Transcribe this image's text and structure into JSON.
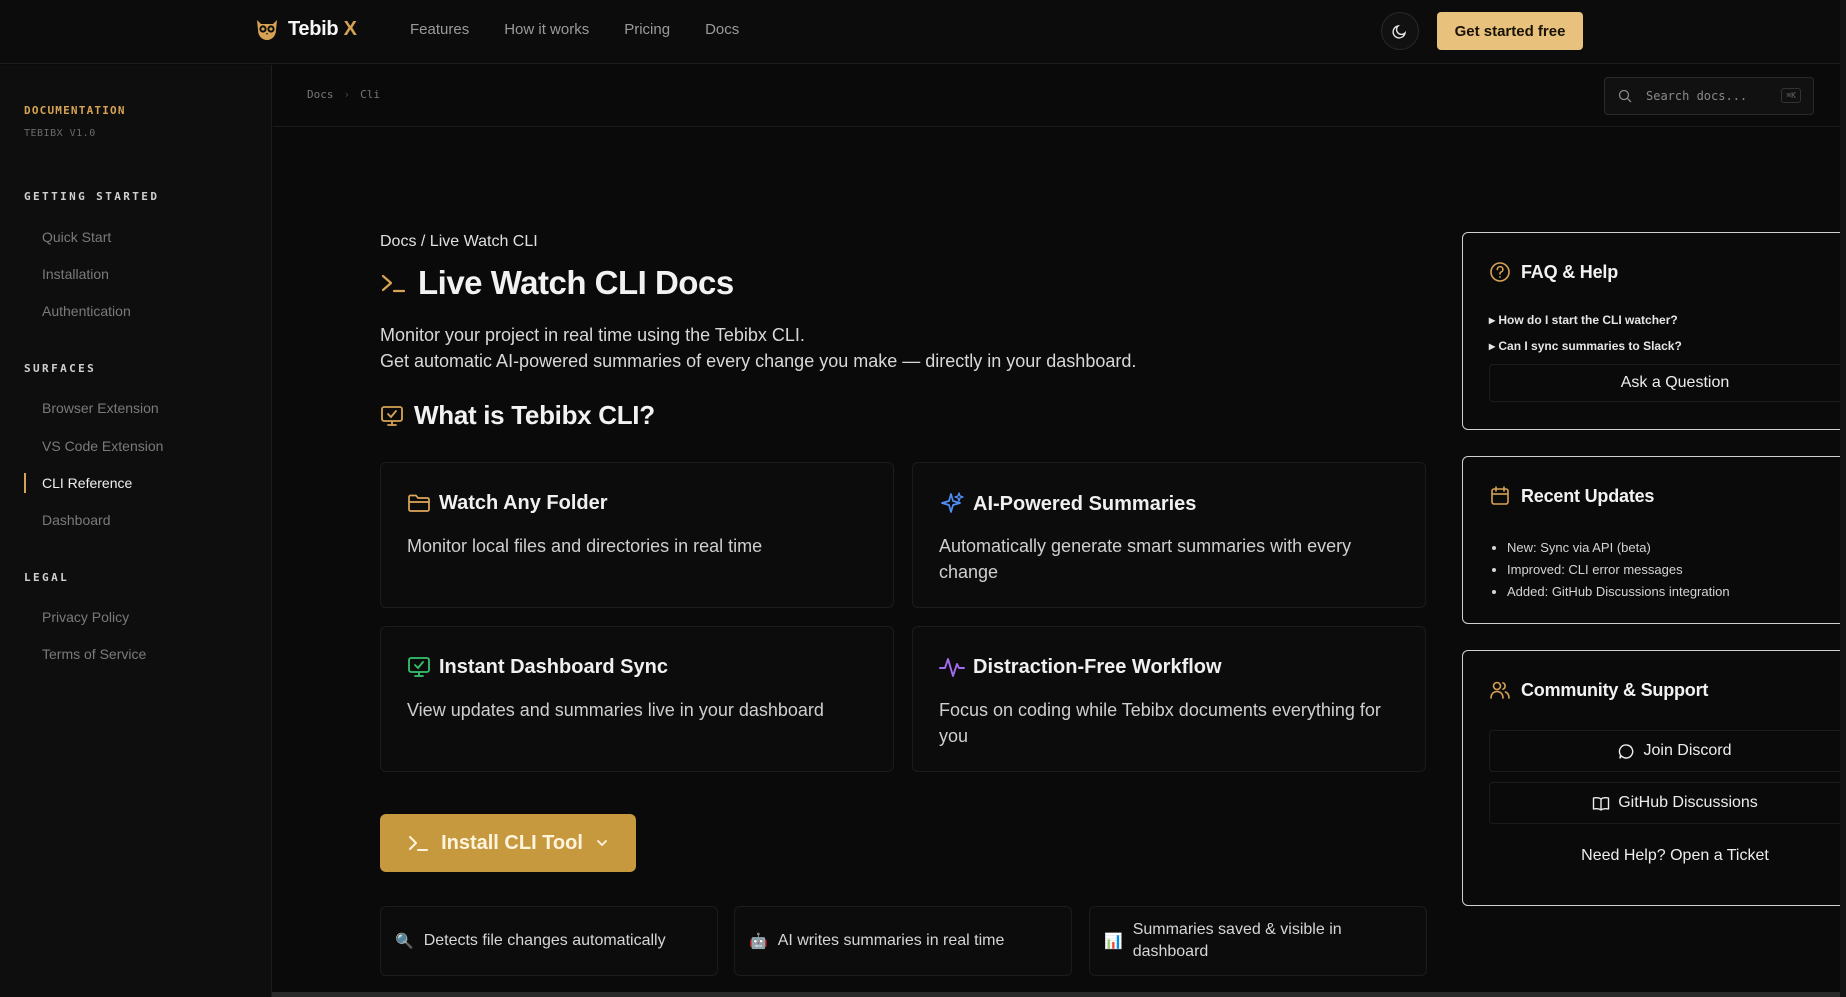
{
  "topnav": {
    "brand": "Tebib",
    "brand_accent": "X",
    "links": [
      "Features",
      "How it works",
      "Pricing",
      "Docs"
    ],
    "cta": "Get started free"
  },
  "sidebar": {
    "title": "DOCUMENTATION",
    "version": "TEBIBX V1.0",
    "sections": [
      {
        "label": "GETTING STARTED",
        "items": [
          "Quick Start",
          "Installation",
          "Authentication"
        ]
      },
      {
        "label": "SURFACES",
        "items": [
          "Browser Extension",
          "VS Code Extension",
          "CLI Reference",
          "Dashboard"
        ]
      },
      {
        "label": "LEGAL",
        "items": [
          "Privacy Policy",
          "Terms of Service"
        ]
      }
    ],
    "active_item": "CLI Reference"
  },
  "crumbbar": {
    "crumbs": [
      "Docs",
      "Cli"
    ],
    "search_placeholder": "Search docs...",
    "search_kbd": "⌘K"
  },
  "main": {
    "breadcrumb": "Docs / Live Watch CLI",
    "title": "Live Watch CLI Docs",
    "intro_line1": "Monitor your project in real time using the Tebibx CLI.",
    "intro_line2": "Get automatic AI-powered summaries of every change you make — directly in your dashboard.",
    "section_title": "What is Tebibx CLI?",
    "features": [
      {
        "title": "Watch Any Folder",
        "desc": "Monitor local files and directories in real time",
        "icon": "folder-icon"
      },
      {
        "title": "AI-Powered Summaries",
        "desc": "Automatically generate smart summaries with every change",
        "icon": "sparkles-icon"
      },
      {
        "title": "Instant Dashboard Sync",
        "desc": "View updates and summaries live in your dashboard",
        "icon": "monitor-icon"
      },
      {
        "title": "Distraction-Free Workflow",
        "desc": "Focus on coding while Tebibx documents everything for you",
        "icon": "activity-icon"
      }
    ],
    "install_button": "Install CLI Tool",
    "pills": [
      {
        "icon": "🔍",
        "text": "Detects file changes automatically"
      },
      {
        "icon": "🤖",
        "text": "AI writes summaries in real time"
      },
      {
        "icon": "📊",
        "text": "Summaries saved & visible in dashboard"
      }
    ]
  },
  "panels": {
    "faq": {
      "title": "FAQ & Help",
      "questions": [
        "How do I start the CLI watcher?",
        "Can I sync summaries to Slack?"
      ],
      "button": "Ask a Question"
    },
    "updates": {
      "title": "Recent Updates",
      "items": [
        "New: Sync via API (beta)",
        "Improved: CLI error messages",
        "Added: GitHub Discussions integration"
      ]
    },
    "community": {
      "title": "Community & Support",
      "discord": "Join Discord",
      "github": "GitHub Discussions",
      "ticket": "Need Help? Open a Ticket"
    }
  },
  "colors": {
    "accent": "#d6a354",
    "cta_bg": "#e8c27c",
    "install_bg": "#c6993f",
    "background": "#0a0a0a"
  }
}
